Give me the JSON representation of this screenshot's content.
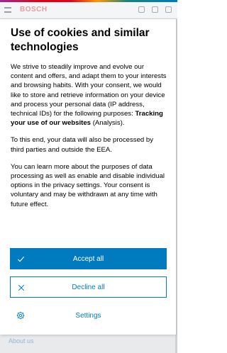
{
  "background": {
    "brand": "BOSCH",
    "footer_link": "About us"
  },
  "modal": {
    "title": "Use of cookies and similar technologies",
    "paragraph1_pre": "We strive to steadily improve and evolve our content and offers, and adapt them to your interests and browsing habits. With your consent, we would like to store and retrieve information on your device and process your personal data (IP address, technical IDs) for the following purposes: ",
    "paragraph1_bold": "Tracking your use of our websites",
    "paragraph1_post": " (Analysis).",
    "paragraph2": "To this end, your data will also be processed by third parties and outside the EEA.",
    "paragraph3": "You can learn more about the purposes of data processing as well as enable and disable individual options in the privacy settings. Your consent is voluntary and may be withdrawn at any time with future effect.",
    "accept_label": "Accept all",
    "decline_label": "Decline all",
    "settings_label": "Settings"
  },
  "icons": {
    "accept": "checkmark-icon",
    "decline": "close-icon",
    "settings": "gear-icon"
  },
  "colors": {
    "accent": "#007bc0",
    "text": "#000000",
    "background": "#ffffff"
  }
}
